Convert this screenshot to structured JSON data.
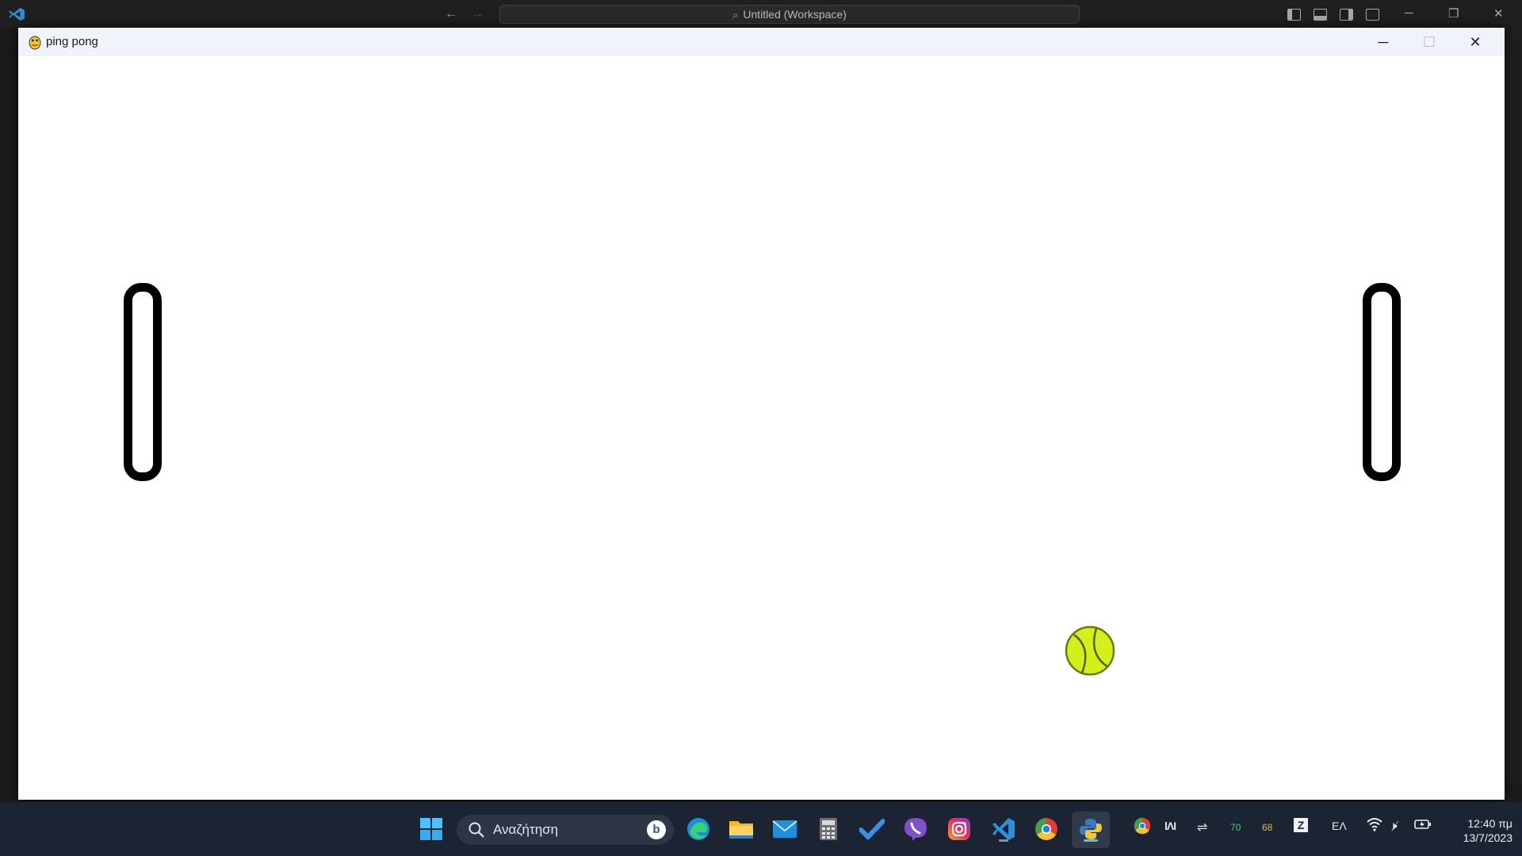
{
  "vscode": {
    "workspace_title": "Untitled (Workspace)"
  },
  "game_window": {
    "title": "ping pong",
    "controls": {
      "minimize": "─",
      "maximize": "☐",
      "close": "✕"
    }
  },
  "taskbar": {
    "search_placeholder": "Αναζήτηση",
    "bing_label": "b",
    "apps": [
      "start-icon",
      "search-icon",
      "edge-icon",
      "file-explorer-icon",
      "mail-icon",
      "calculator-icon",
      "todo-icon",
      "viber-icon",
      "instagram-icon",
      "vscode-icon",
      "chrome-icon",
      "python-icon"
    ],
    "tray": {
      "temp_gpu": "70",
      "temp_cpu": "68",
      "language": "ΕΛ"
    },
    "clock": {
      "time": "12:40 πμ",
      "date": "13/7/2023"
    }
  },
  "colors": {
    "ball": "#d4f019",
    "paddle_outline": "#000000",
    "taskbar": "#1c2433",
    "accent": "#4cc2ff"
  }
}
